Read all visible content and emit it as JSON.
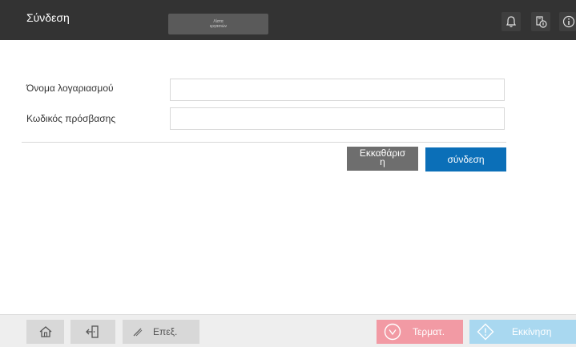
{
  "header": {
    "title": "Σύνδεση",
    "job_status_line1": "Λίστα",
    "job_status_line2": "εργασιών"
  },
  "form": {
    "username_label": "Όνομα λογαριασμού",
    "username_value": "",
    "password_label": "Κωδικός πρόσβασης",
    "password_value": ""
  },
  "actions": {
    "clear_label_line1": "Εκκαθάρισ",
    "clear_label_line2": "η",
    "login_label": "σύνδεση"
  },
  "footer": {
    "edit_label": "Επεξ.",
    "stop_label": "Τερματ.",
    "start_label": "Εκκίνηση"
  },
  "icons": {
    "bell": "bell-icon",
    "usb": "usb-device-icon",
    "info": "info-icon",
    "home": "home-icon",
    "logout": "logout-icon",
    "edit": "pencil-icon",
    "stop": "stop-icon",
    "start": "start-icon"
  },
  "colors": {
    "topbar": "#333333",
    "primary": "#0b6fb8",
    "clear_button": "#6e6e6e",
    "stop_button": "#f29aa4",
    "start_button": "#a9d8f0"
  }
}
